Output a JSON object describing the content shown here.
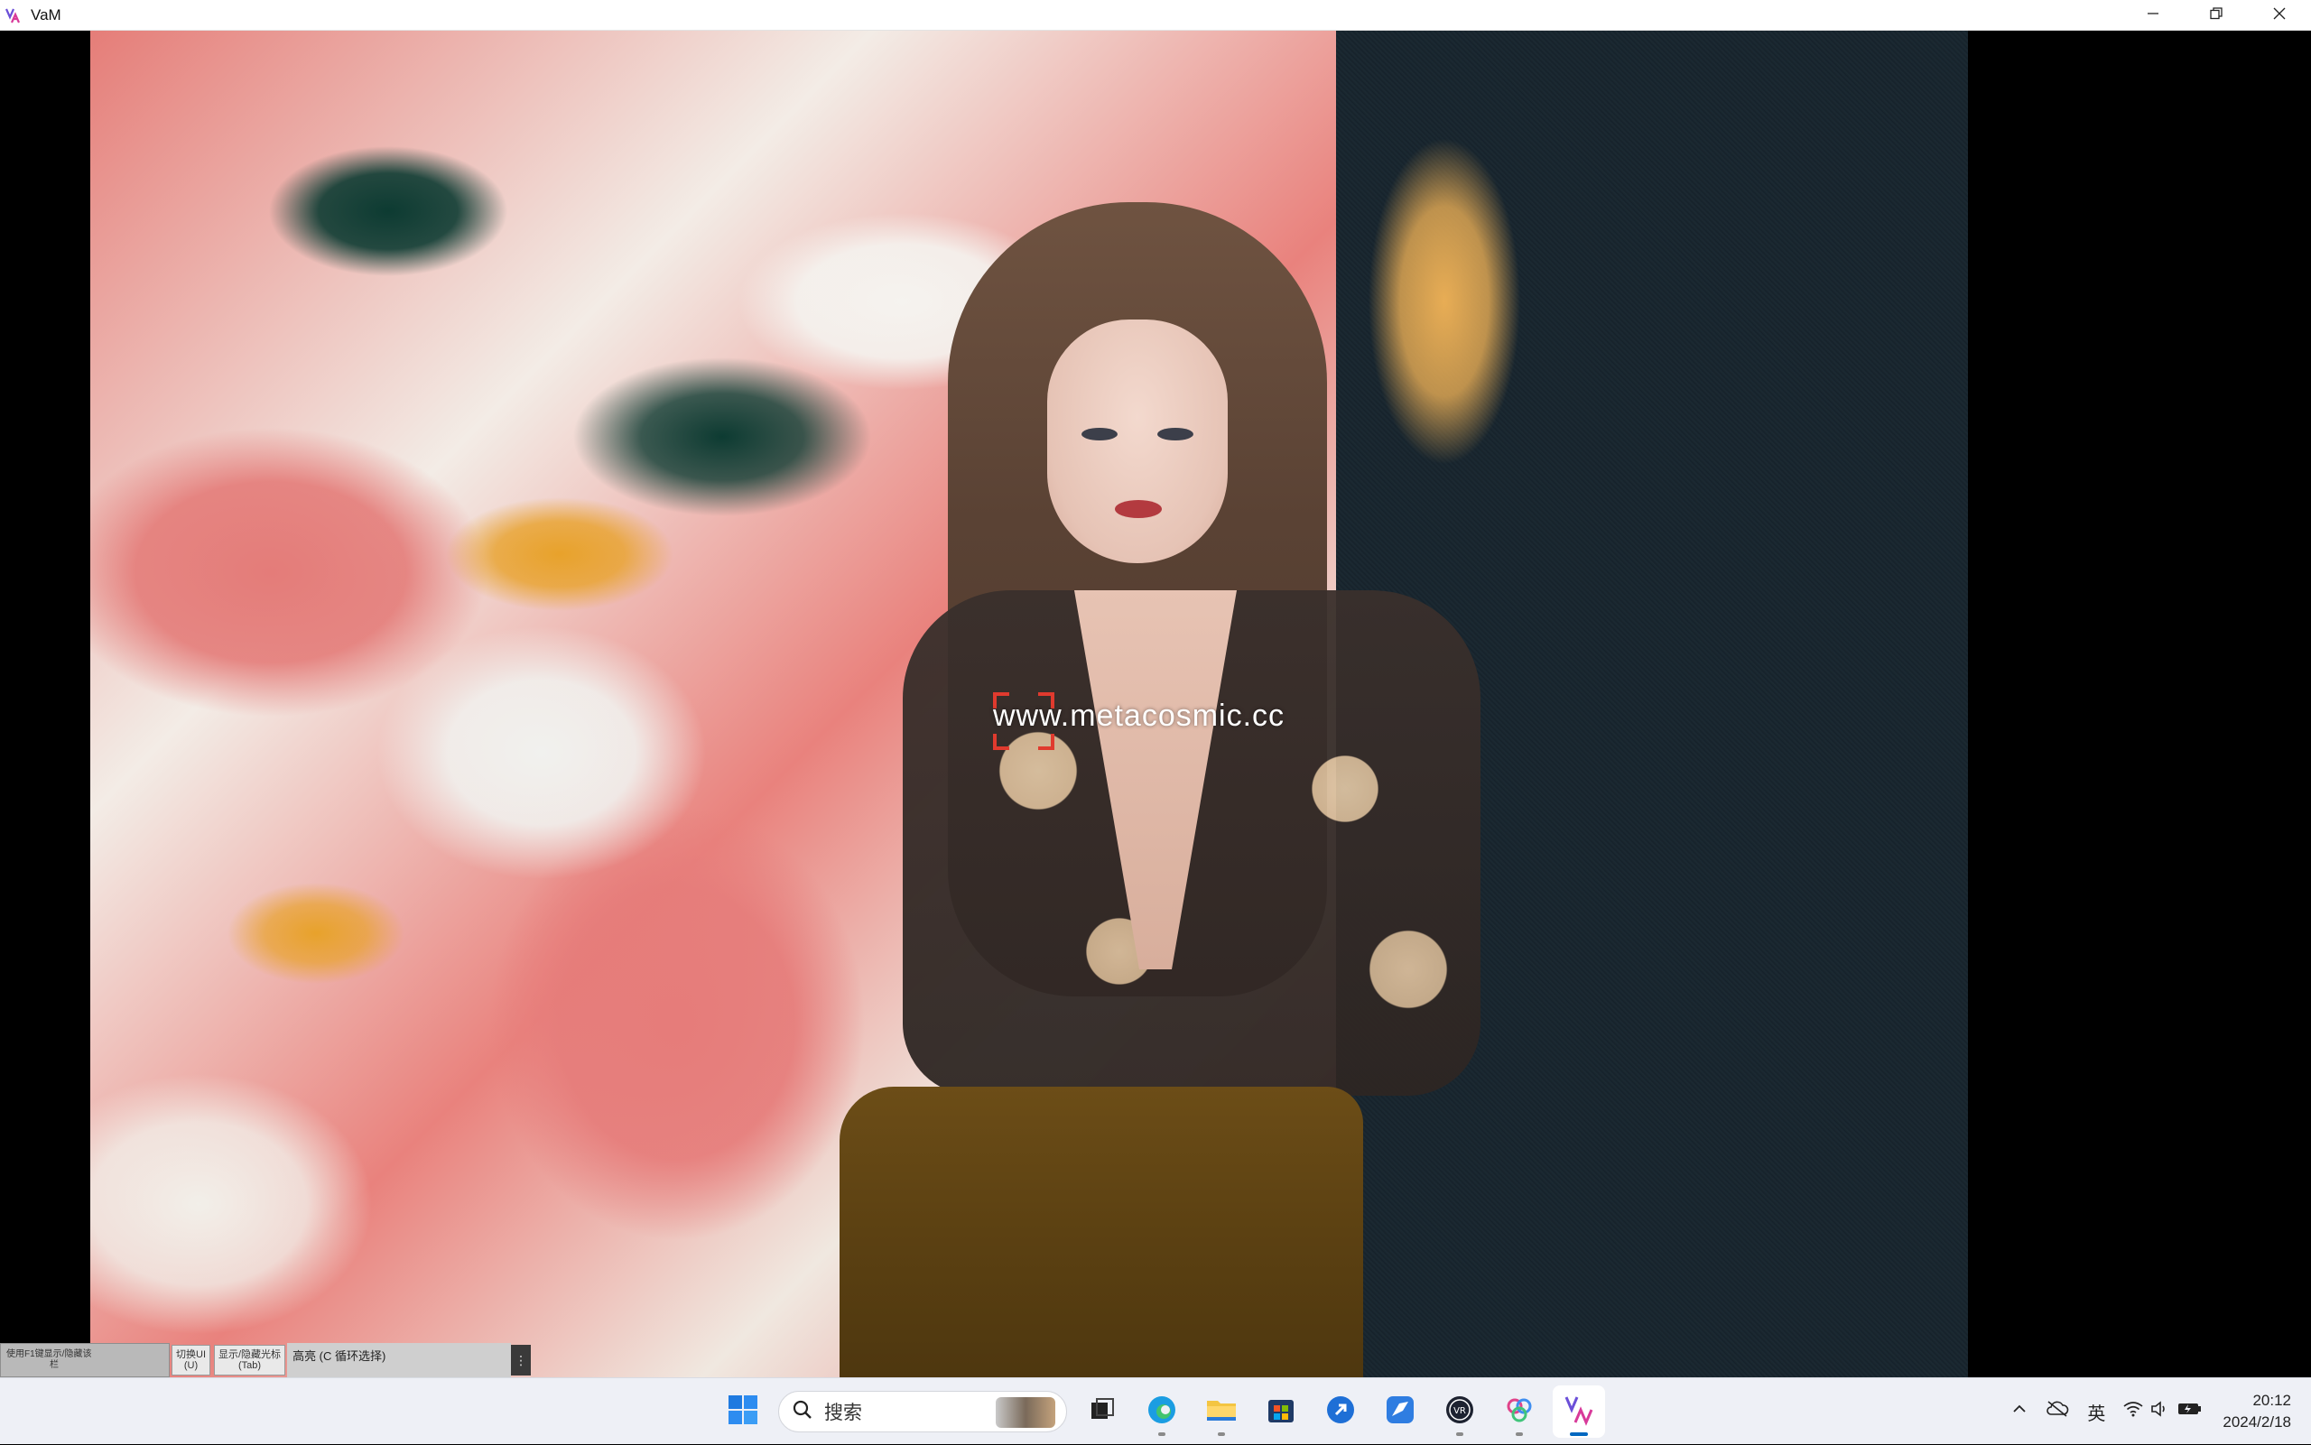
{
  "window": {
    "title": "VaM",
    "controls": {
      "minimize": "minimize-icon",
      "restore": "restore-icon",
      "close": "close-icon"
    }
  },
  "viewport": {
    "watermark": "www.metacosmic.cc"
  },
  "hint_bar": {
    "main_line1": "使用F1键显示/隐藏该",
    "main_line2": "栏",
    "toggle_ui_label": "切换UI",
    "toggle_ui_key": "(U)",
    "cursor_label": "显示/隐藏光标",
    "cursor_key": "(Tab)",
    "highlight_label": "高亮 (C 循环选择)",
    "more": "⋮"
  },
  "taskbar": {
    "search_placeholder": "搜索",
    "apps": [
      {
        "name": "start",
        "icon": "windows-start-icon"
      },
      {
        "name": "task-view",
        "icon": "task-view-icon"
      },
      {
        "name": "edge",
        "icon": "edge-browser-icon"
      },
      {
        "name": "file-explorer",
        "icon": "folder-icon"
      },
      {
        "name": "store",
        "icon": "store-icon"
      },
      {
        "name": "app-blue-arrow",
        "icon": "arrow-app-icon"
      },
      {
        "name": "app-bird",
        "icon": "bird-app-icon"
      },
      {
        "name": "vr",
        "icon": "vr-icon"
      },
      {
        "name": "app-rings",
        "icon": "rings-app-icon"
      },
      {
        "name": "vam",
        "icon": "vam-icon"
      }
    ],
    "tray": {
      "ime": "英",
      "time": "20:12",
      "date": "2024/2/18"
    }
  },
  "colors": {
    "accent": "#0067c0",
    "reticle": "#e03a2e"
  }
}
